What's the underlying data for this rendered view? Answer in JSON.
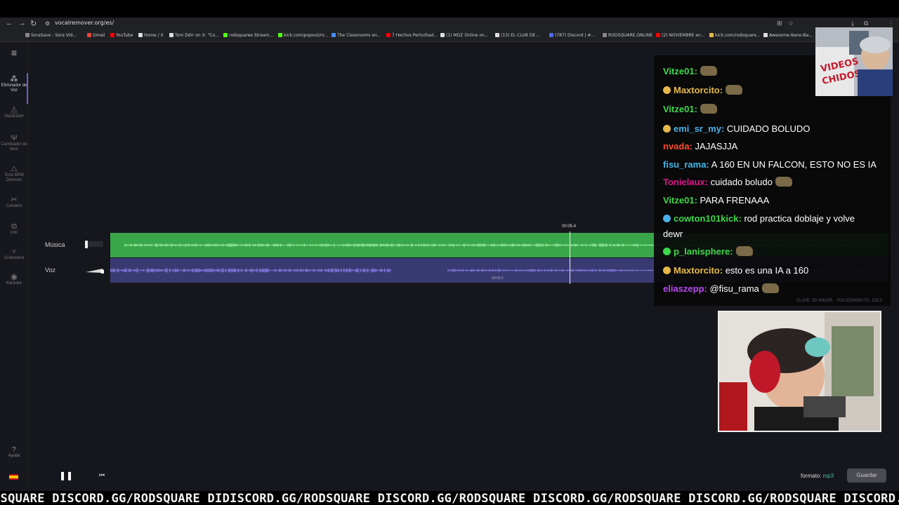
{
  "browser": {
    "url": "vocalremover.org/es/",
    "bookmarks": [
      {
        "label": "SoraSave - Sora Vid...",
        "color": "#888888"
      },
      {
        "label": "Gmail",
        "color": "#ea4335"
      },
      {
        "label": "YouTube",
        "color": "#ff0000"
      },
      {
        "label": "Home / X",
        "color": "#dddddd"
      },
      {
        "label": "Tom Ddrr on X: \"Co...",
        "color": "#dddddd"
      },
      {
        "label": "rodsquaree Stream...",
        "color": "#53fc18"
      },
      {
        "label": "kick.com/popout/ro...",
        "color": "#53fc18"
      },
      {
        "label": "The Classrooms en...",
        "color": "#4a8cff"
      },
      {
        "label": "7 Hechos Perturbad...",
        "color": "#ff0000"
      },
      {
        "label": "(1) MDZ Online on...",
        "color": "#dddddd"
      },
      {
        "label": "(13) EL CLUB DE...",
        "color": "#dddddd"
      },
      {
        "label": "(787) Discord | #...",
        "color": "#5865f2"
      },
      {
        "label": "RODSQUARE.ONLINE",
        "color": "#888888"
      },
      {
        "label": "(2) NOVIEMBRE en...",
        "color": "#ff0000"
      },
      {
        "label": "kick.com/rodsquare...",
        "color": "#e6b84a"
      },
      {
        "label": "Awesome-Nano-Ba...",
        "color": "#dddddd"
      }
    ]
  },
  "sidebar": {
    "items": [
      {
        "label": "Eliminador de Voz",
        "icon": "vocal-remover-icon",
        "active": true
      },
      {
        "label": "Separador",
        "icon": "splitter-icon"
      },
      {
        "label": "Cambiador de tono",
        "icon": "pitch-icon"
      },
      {
        "label": "Tono BPM Detector",
        "icon": "metronome-icon"
      },
      {
        "label": "Cortador",
        "icon": "scissors-icon"
      },
      {
        "label": "Unir",
        "icon": "join-icon"
      },
      {
        "label": "Grabadora",
        "icon": "microphone-icon"
      },
      {
        "label": "Karaoke",
        "icon": "disc-icon"
      }
    ],
    "help": "Ayuda"
  },
  "tracks": {
    "music_label": "Música",
    "voice_label": "Voz",
    "music_color": "#39a64a",
    "voice_color": "#3a3a72"
  },
  "player": {
    "current_time": "00:05.4",
    "marker_time": "00:09.2",
    "format_label": "formato:",
    "format_value": "mp3",
    "save_label": "Guardar"
  },
  "chat": {
    "messages": [
      {
        "user": "Vitze01",
        "color": "#3dd84a",
        "text": "",
        "emote": true
      },
      {
        "user": "Maxtorcito",
        "color": "#e6b84a",
        "text": "",
        "emote": true,
        "badge": "yellow"
      },
      {
        "user": "Vitze01",
        "color": "#3dd84a",
        "text": "",
        "emote": true
      },
      {
        "user": "emi_sr_my",
        "color": "#4ab0e6",
        "text": " CUIDADO BOLUDO",
        "badge": "yellow"
      },
      {
        "user": "nvada",
        "color": "#ff4a2a",
        "text": " JAJASJJA"
      },
      {
        "user": "fisu_rama",
        "color": "#3fb8e8",
        "text": " A 160 EN UN FALCON, ESTO NO ES IA"
      },
      {
        "user": "Tonielaux",
        "color": "#e0158c",
        "text": " cuidado boludo",
        "emote": true
      },
      {
        "user": "Vitze01",
        "color": "#3dd84a",
        "text": " PARA FRENAAA"
      },
      {
        "user": "cowton101kick",
        "color": "#3dd84a",
        "text": " rod practica doblaje y volve",
        "badge": "blue",
        "wrap": "dewr"
      },
      {
        "user": "p_lanisphere",
        "color": "#3dd84a",
        "text": "",
        "emote": true,
        "badge": "green"
      },
      {
        "user": "Maxtorcito",
        "color": "#e6b84a",
        "text": " esto es una IA a 160",
        "badge": "yellow"
      },
      {
        "user": "eliaszepp",
        "color": "#b84af0",
        "text": " @fisu_rama",
        "emote": true
      }
    ],
    "meta_key": "CLAVE",
    "meta_key_val": "Eb MINOR",
    "meta_bpm": "PULSO/MINUTO",
    "meta_bpm_val": "125.0"
  },
  "ticker": {
    "text": "DSQUARE DISCORD.GG/RODSQUARE DIDISCORD.GG/RODSQUARE DISCORD.GG/RODSQUARE DISCORD.GG/RODSQUARE DISCORD.GG/RODSQUARE DISCORD.GG/RODSQUARE"
  }
}
